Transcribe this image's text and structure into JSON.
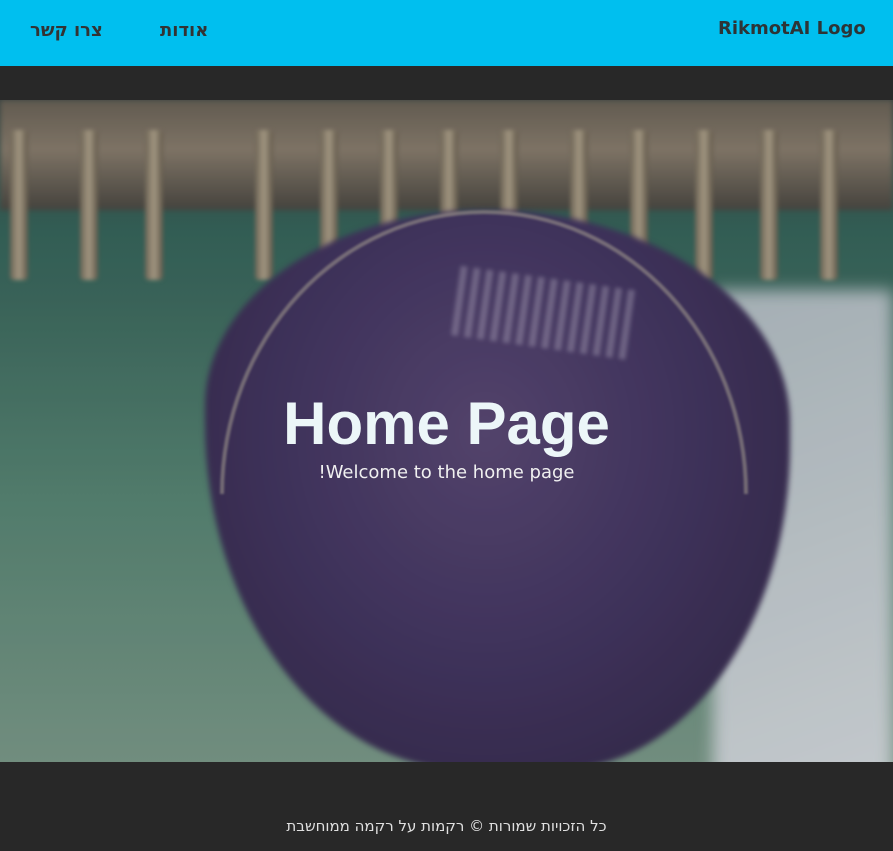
{
  "header": {
    "logo_text": "RikmotAI Logo",
    "nav": [
      {
        "label": "אודות"
      },
      {
        "label": "צרו קשר"
      }
    ],
    "background_color": "#00bfef"
  },
  "hero": {
    "title": "Home Page",
    "subtitle": "Welcome to the home page!"
  },
  "footer": {
    "text": "כל הזכויות שמורות © רקמות על רקמה ממוחשבת",
    "background_color": "#282828"
  }
}
